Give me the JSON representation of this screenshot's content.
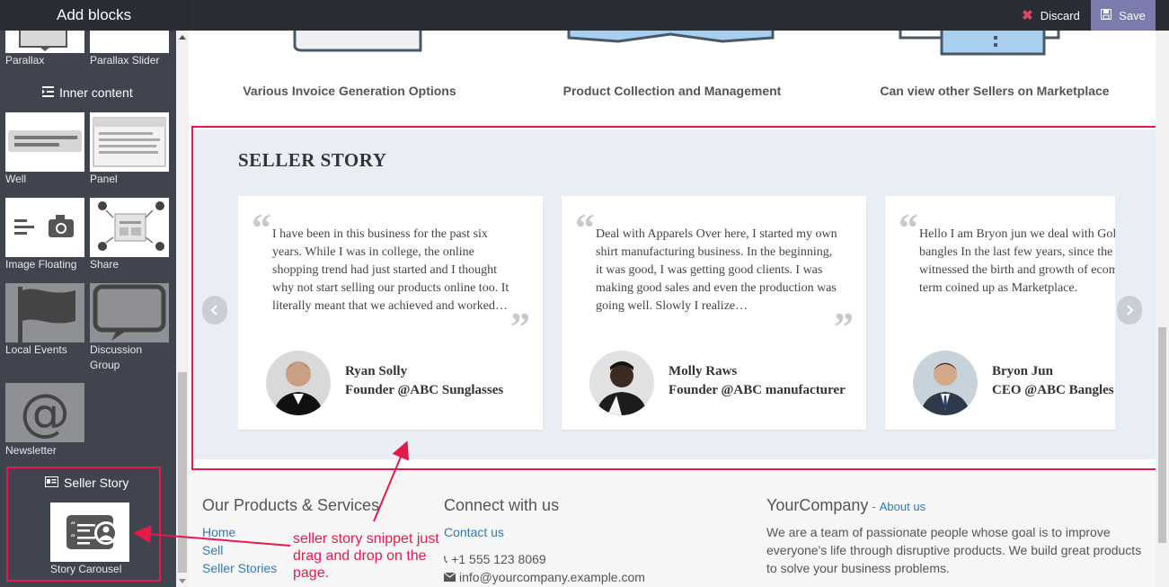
{
  "sidebar": {
    "title": "Add blocks",
    "blocks_top": [
      {
        "label": "Parallax"
      },
      {
        "label": "Parallax Slider"
      }
    ],
    "inner_content_title": "Inner content",
    "blocks_inner": [
      {
        "label": "Well"
      },
      {
        "label": "Panel"
      },
      {
        "label": "Image Floating"
      },
      {
        "label": "Share"
      },
      {
        "label": "Local Events"
      },
      {
        "label": "Discussion Group"
      },
      {
        "label": "Newsletter"
      }
    ],
    "seller_story_title": "Seller Story",
    "story_block_label": "Story Carousel"
  },
  "toolbar": {
    "discard_label": "Discard",
    "save_label": "Save"
  },
  "features": [
    {
      "title": "Various Invoice Generation Options"
    },
    {
      "title": "Product Collection and Management"
    },
    {
      "title": "Can view other Sellers on Marketplace"
    }
  ],
  "story": {
    "heading": "SELLER STORY",
    "cards": [
      {
        "text": "I have been in this business for the past six years. While I was in college, the online shopping trend had just started and I thought why not start selling our products online too. It literally meant that we achieved and worked…",
        "name": "Ryan Solly",
        "role": "Founder @ABC Sunglasses"
      },
      {
        "text": "Deal with Apparels Over here, I started my own shirt manufacturing business. In the beginning, it was good, I was getting good clients. I was making good sales and even the production was going well. Slowly I realize…",
        "name": "Molly Raws",
        "role": "Founder @ABC manufacturer"
      },
      {
        "text": "Hello I am Bryon jun we deal with Golden bangles In the last few years, since the time, witnessed the birth and growth of ecommerce, a term coined up as Marketplace.",
        "name": "Bryon Jun",
        "role": "CEO @ABC Bangles"
      }
    ]
  },
  "footer": {
    "products_heading": "Our Products & Services",
    "products_links": [
      "Home",
      "Sell",
      "Seller Stories"
    ],
    "connect_heading": "Connect with us",
    "contact_link": "Contact us",
    "phone": "+1 555 123 8069",
    "email": "info@yourcompany.example.com",
    "company_heading": "YourCompany",
    "about_prefix": "-",
    "about_link": "About us",
    "company_text": "We are a team of passionate people whose goal is to improve everyone's life through disruptive products. We build great products to solve your business problems."
  },
  "annotation": {
    "text": "seller story snippet just drag and drop on the page."
  },
  "colors": {
    "highlight": "#e6194b",
    "save_accent": "#7c7bad",
    "sidebar_bg": "#3f444f",
    "section_bg": "#e8eef4",
    "link": "#337ab7"
  }
}
